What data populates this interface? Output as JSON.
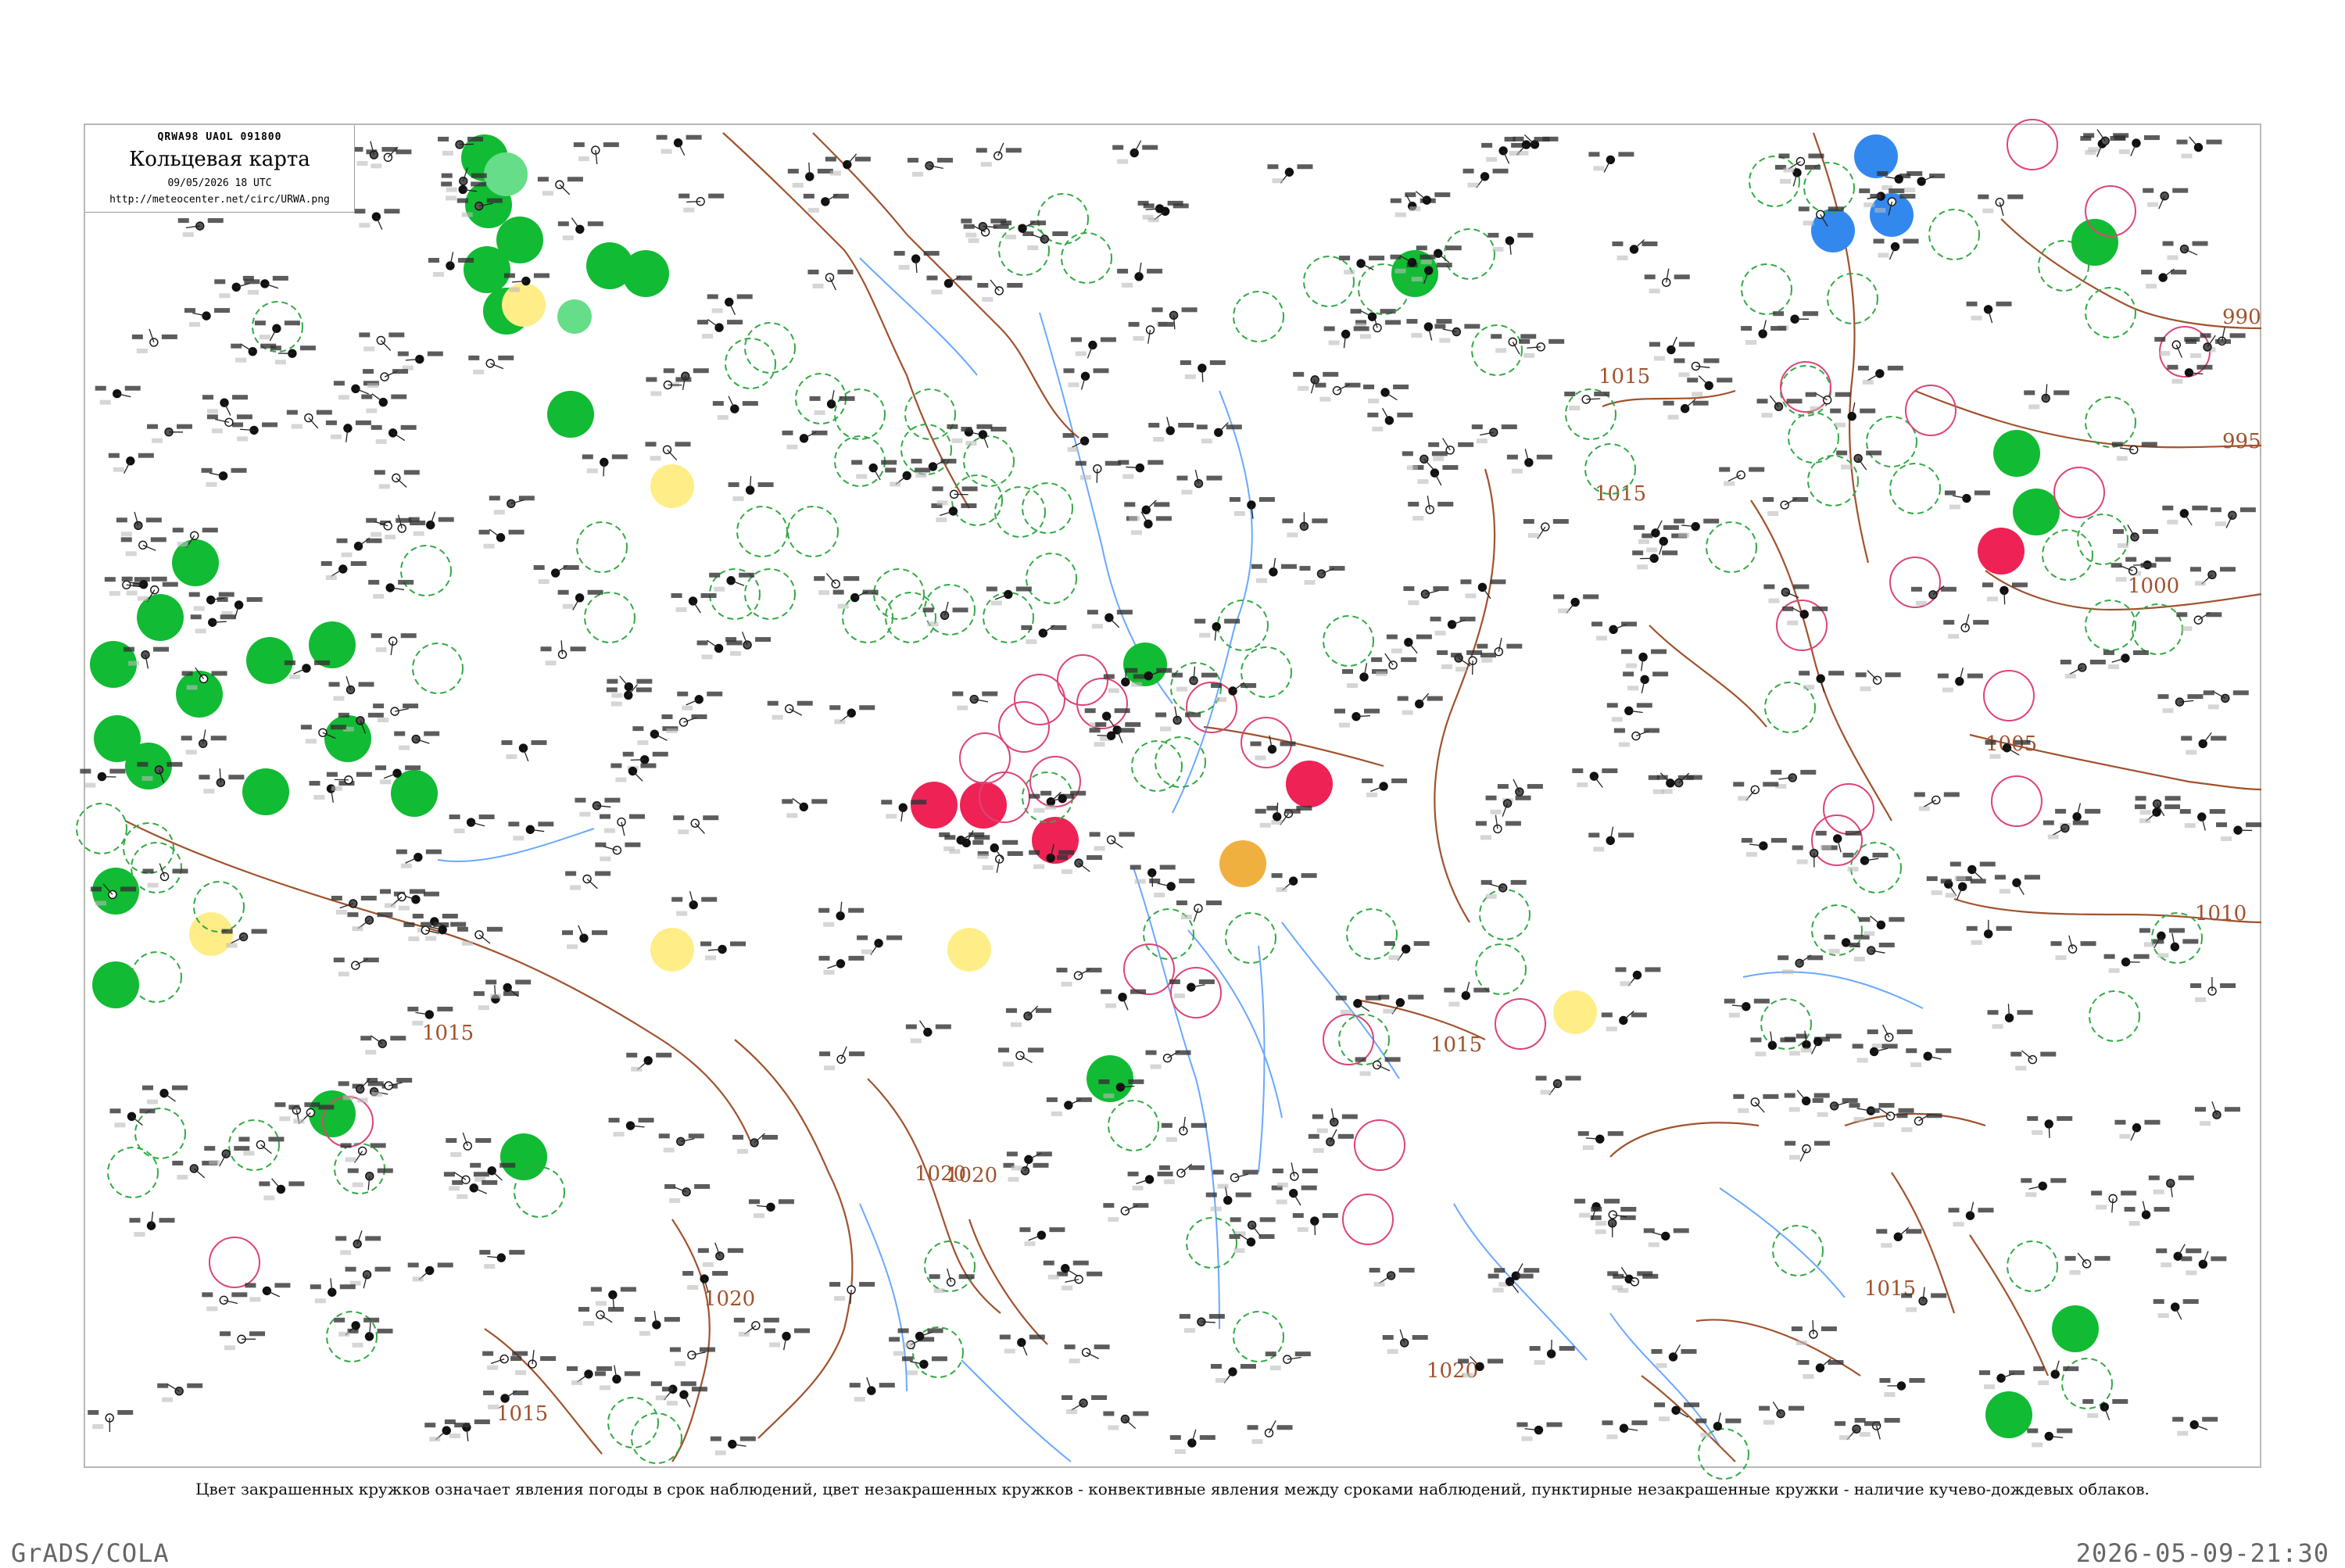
{
  "header": {
    "code": "QRWA98 UAOL 091800",
    "title": "Кольцевая карта",
    "datetime": "09/05/2026 18 UTC",
    "url": "http://meteocenter.net/circ/URWA.png"
  },
  "caption": "Цвет закрашенных кружков означает явления погоды в срок наблюдений, цвет незакрашенных кружков - конвективные явления между сроками наблюдений, пунктирные незакрашенные кружки - наличие кучево-дождевых облаков.",
  "footer": {
    "left": "GrADS/COLA",
    "right": "2026-05-09-21:30"
  },
  "isobar_labels": [
    "1015",
    "1020",
    "1020",
    "1015",
    "1015",
    "1020",
    "1015",
    "1015",
    "990",
    "995",
    "1000",
    "1005",
    "1010",
    "1015",
    "1020"
  ],
  "colors": {
    "precip_green": "#11bb33",
    "light_green": "#66dd88",
    "yellow": "#ffee88",
    "orange": "#f0b040",
    "red": "#ee2255",
    "blue": "#3388ee",
    "dashed_green": "#33aa44",
    "pink_ring": "#dd4477",
    "isobar": "#a0522d",
    "river": "#6aa8ff"
  },
  "legend_types": {
    "filled_circle": "weather phenomena at observation time",
    "open_circle": "convective phenomena between observation times",
    "dashed_open_circle": "cumulonimbus clouds present"
  }
}
